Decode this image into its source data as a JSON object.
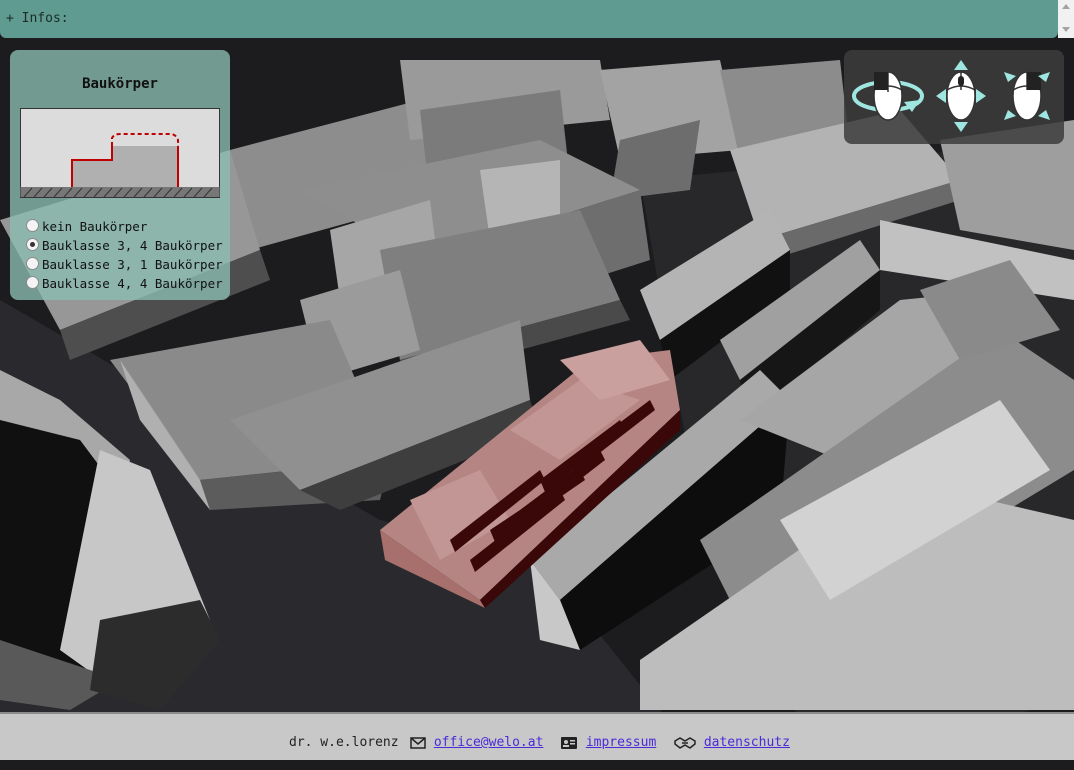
{
  "infobar": {
    "label": "+ Infos:"
  },
  "panel": {
    "title": "Baukörper",
    "options": [
      {
        "label": "kein Baukörper",
        "selected": false
      },
      {
        "label": "Bauklasse 3, 4 Baukörper",
        "selected": true
      },
      {
        "label": "Bauklasse 3, 1 Baukörper",
        "selected": false
      },
      {
        "label": "Bauklasse 4, 4 Baukörper",
        "selected": false
      }
    ]
  },
  "controls": {
    "icons": [
      "rotate-mouse-icon",
      "pan-mouse-icon",
      "zoom-mouse-icon"
    ]
  },
  "footer": {
    "author": "dr. w.e.lorenz",
    "email": "office@welo.at",
    "impressum": "impressum",
    "datenschutz": "datenschutz"
  },
  "colors": {
    "infobar": "#5f9b90",
    "panel": "#8cbeb2",
    "highlight_building": "#b87e7b",
    "footer": "#c8c8c8",
    "link": "#4b2bd8"
  }
}
